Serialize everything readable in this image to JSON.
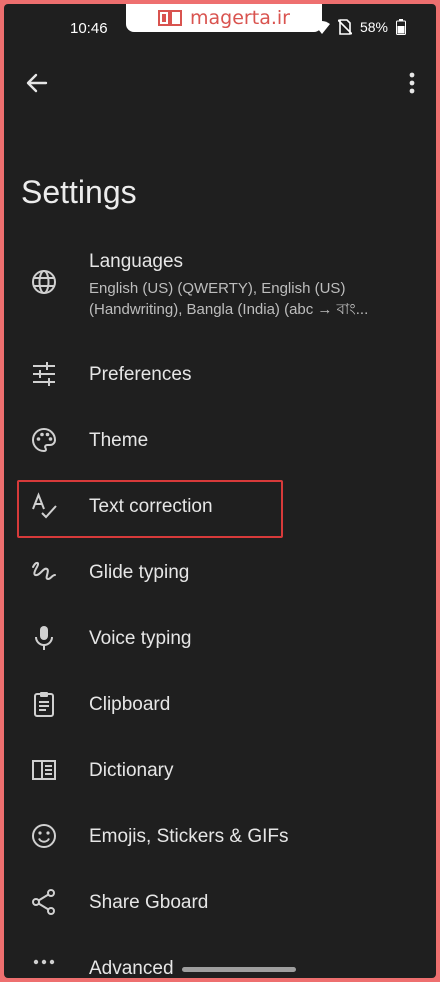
{
  "status_bar": {
    "time": "10:46",
    "battery": "58%",
    "watermark_text": "magerta.ir"
  },
  "app_bar": {
    "title": "Settings"
  },
  "settings": {
    "languages": {
      "label": "Languages",
      "description": "English (US) (QWERTY), English (US) (Handwriting), Bangla (India) (abc → বাং..."
    },
    "preferences": {
      "label": "Preferences"
    },
    "theme": {
      "label": "Theme"
    },
    "text_correction": {
      "label": "Text correction"
    },
    "glide_typing": {
      "label": "Glide typing"
    },
    "voice_typing": {
      "label": "Voice typing"
    },
    "clipboard": {
      "label": "Clipboard"
    },
    "dictionary": {
      "label": "Dictionary"
    },
    "emojis": {
      "label": "Emojis, Stickers & GIFs"
    },
    "share": {
      "label": "Share Gboard"
    },
    "advanced": {
      "label": "Advanced"
    }
  },
  "colors": {
    "background": "#1f1f1f",
    "text": "#e6e6e6",
    "highlight": "#d73a3a",
    "frame": "#ee6f6f"
  }
}
